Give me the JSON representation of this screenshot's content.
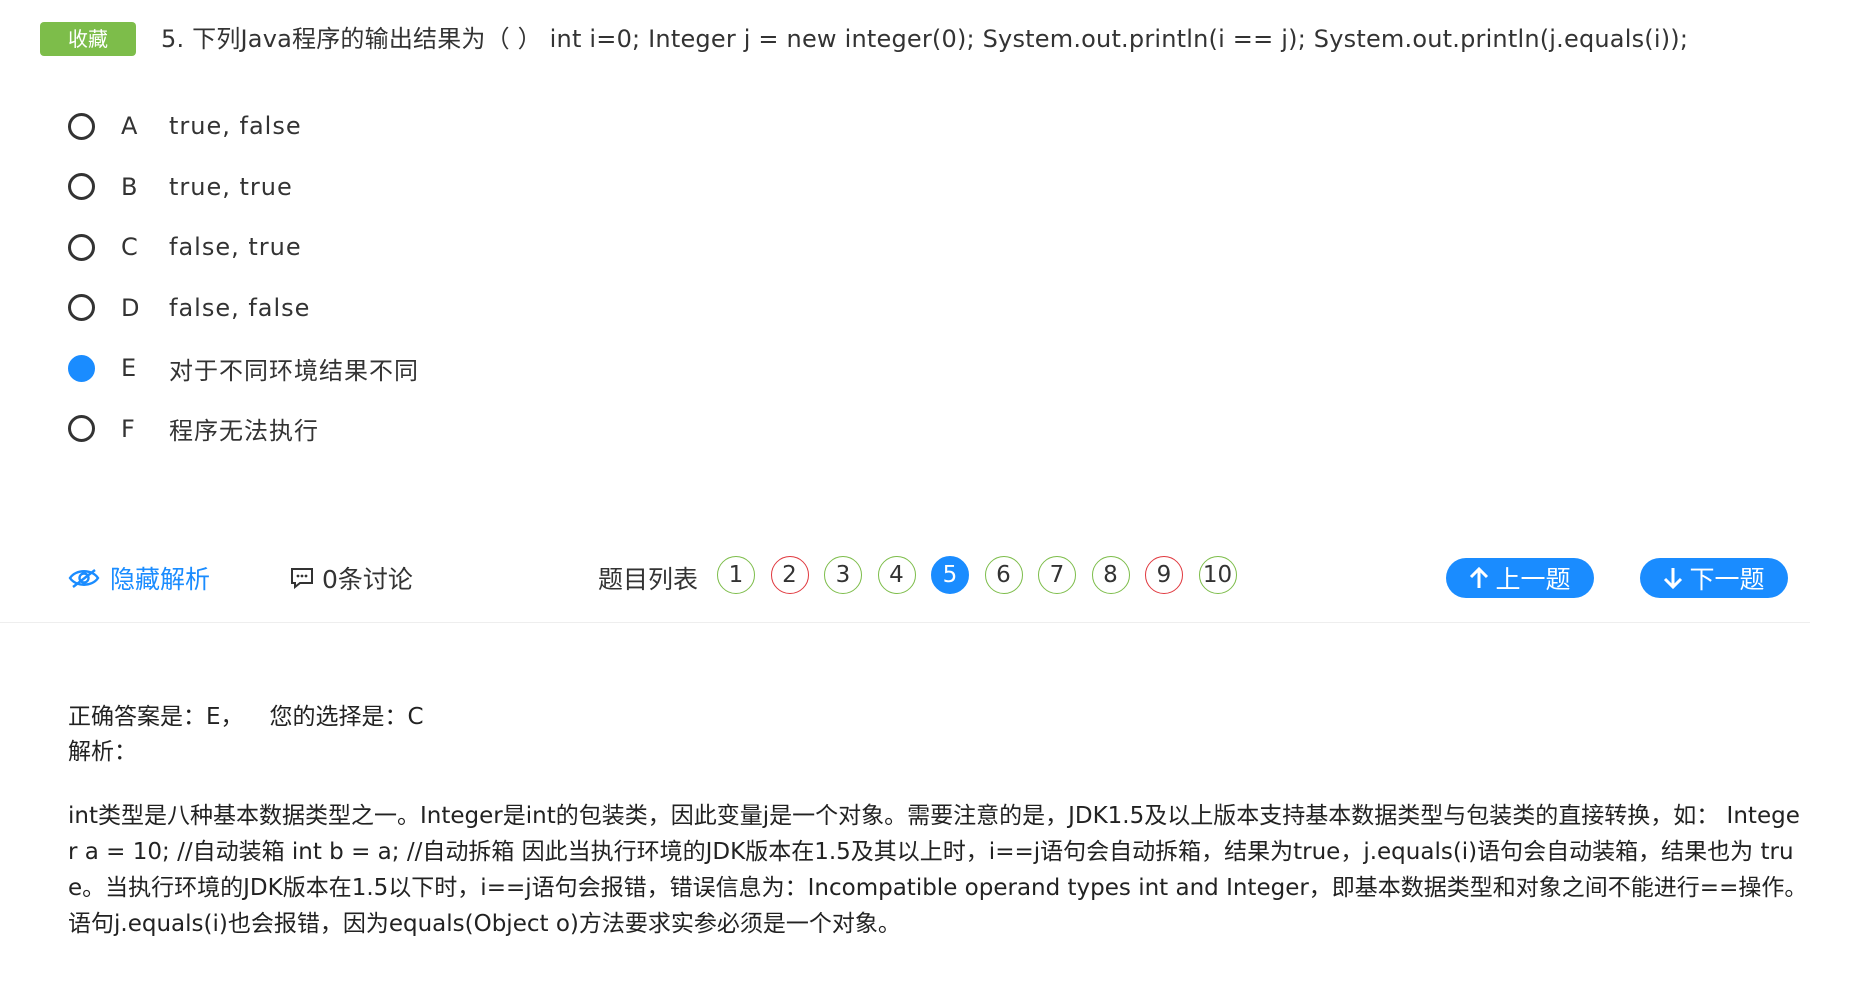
{
  "header": {
    "favorite_label": "收藏",
    "question_text": "5. 下列Java程序的输出结果为（ ） int i=0; Integer j = new integer(0); System.out.println(i == j); System.out.println(j.equals(i));"
  },
  "options": [
    {
      "letter": "A",
      "text": "true, false",
      "selected": false
    },
    {
      "letter": "B",
      "text": "true, true",
      "selected": false
    },
    {
      "letter": "C",
      "text": "false, true",
      "selected": false
    },
    {
      "letter": "D",
      "text": "false, false",
      "selected": false
    },
    {
      "letter": "E",
      "text": "对于不同环境结果不同",
      "selected": true
    },
    {
      "letter": "F",
      "text": "程序无法执行",
      "selected": false
    }
  ],
  "toolbar": {
    "hide_analysis_label": "隐藏解析",
    "discussion_label": "0条讨论",
    "question_list_label": "题目列表",
    "question_numbers": [
      {
        "n": "1",
        "status": "correct"
      },
      {
        "n": "2",
        "status": "wrong"
      },
      {
        "n": "3",
        "status": "correct"
      },
      {
        "n": "4",
        "status": "correct"
      },
      {
        "n": "5",
        "status": "current"
      },
      {
        "n": "6",
        "status": "correct"
      },
      {
        "n": "7",
        "status": "correct"
      },
      {
        "n": "8",
        "status": "correct"
      },
      {
        "n": "9",
        "status": "wrong"
      },
      {
        "n": "10",
        "status": "correct"
      }
    ],
    "prev_label": "上一题",
    "next_label": "下一题"
  },
  "analysis": {
    "correct_answer_text": "正确答案是：E，",
    "your_choice_text": "您的选择是：C",
    "label": "解析：",
    "body": "int类型是八种基本数据类型之一。Integer是int的包装类，因此变量j是一个对象。需要注意的是，JDK1.5及以上版本支持基本数据类型与包装类的直接转换，如： Integer a = 10; //自动装箱 int b = a; //自动拆箱 因此当执行环境的JDK版本在1.5及其以上时，i==j语句会自动拆箱，结果为true，j.equals(i)语句会自动装箱，结果也为 true。当执行环境的JDK版本在1.5以下时，i==j语句会报错，错误信息为：Incompatible operand types int and Integer，即基本数据类型和对象之间不能进行==操作。语句j.equals(i)也会报错，因为equals(Object o)方法要求实参必须是一个对象。"
  },
  "colors": {
    "accent": "#1a8cff",
    "favorite_green": "#7dbd4a",
    "wrong_red": "#e0383e"
  },
  "icons": {
    "hide_analysis": "eye-icon",
    "discussion": "comment-icon",
    "prev": "arrow-up-icon",
    "next": "arrow-down-icon"
  }
}
